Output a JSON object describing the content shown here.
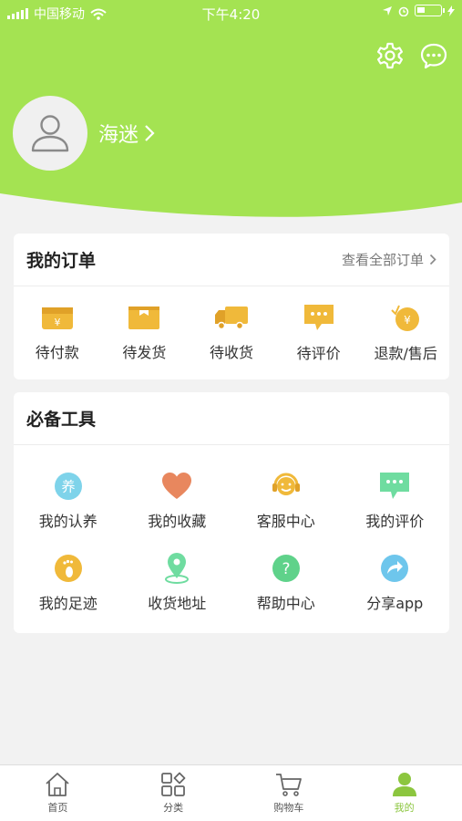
{
  "status_bar": {
    "carrier": "中国移动",
    "time": "下午4:20"
  },
  "profile": {
    "username": "海迷",
    "chevron": "›"
  },
  "orders": {
    "title": "我的订单",
    "view_all": "查看全部订单",
    "items": [
      {
        "label": "待付款",
        "icon": "wallet-icon"
      },
      {
        "label": "待发货",
        "icon": "package-icon"
      },
      {
        "label": "待收货",
        "icon": "truck-icon"
      },
      {
        "label": "待评价",
        "icon": "comment-icon"
      },
      {
        "label": "退款/售后",
        "icon": "refund-coin-icon"
      }
    ]
  },
  "tools": {
    "title": "必备工具",
    "items": [
      {
        "label": "我的认养",
        "icon": "adopt-icon",
        "glyph": "养"
      },
      {
        "label": "我的收藏",
        "icon": "heart-icon"
      },
      {
        "label": "客服中心",
        "icon": "customer-service-icon"
      },
      {
        "label": "我的评价",
        "icon": "review-icon"
      },
      {
        "label": "我的足迹",
        "icon": "footprint-icon"
      },
      {
        "label": "收货地址",
        "icon": "location-pin-icon"
      },
      {
        "label": "帮助中心",
        "icon": "help-icon",
        "glyph": "?"
      },
      {
        "label": "分享app",
        "icon": "share-icon"
      }
    ]
  },
  "tabbar": {
    "items": [
      {
        "label": "首页",
        "icon": "home-icon"
      },
      {
        "label": "分类",
        "icon": "category-icon"
      },
      {
        "label": "购物车",
        "icon": "cart-icon"
      },
      {
        "label": "我的",
        "icon": "user-icon",
        "active": true
      }
    ]
  },
  "colors": {
    "brand_green": "#a4e352",
    "active_tab": "#8cc63f",
    "gold": "#f0b93a"
  }
}
